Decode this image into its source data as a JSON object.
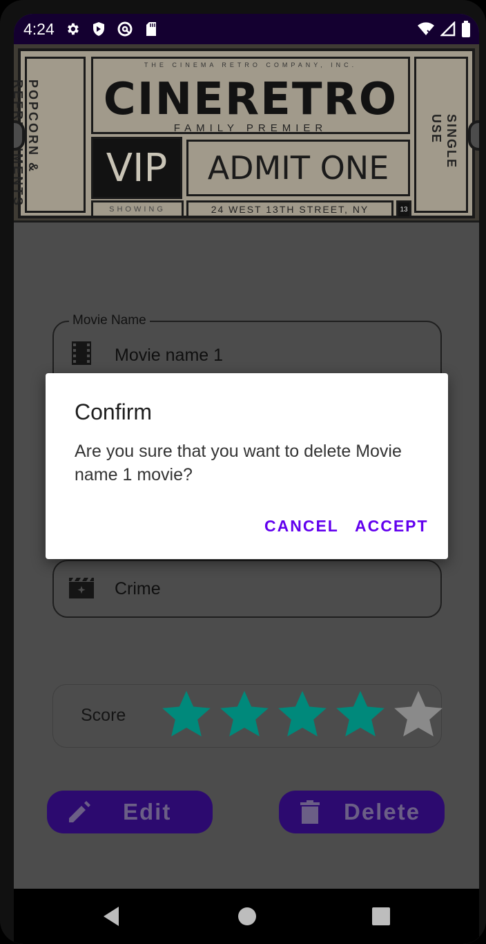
{
  "status_bar": {
    "time": "4:24",
    "icons": [
      "gear-icon",
      "shield-icon",
      "at-sign-icon",
      "sd-card-icon"
    ],
    "right_icons": [
      "wifi-off-icon",
      "signal-icon",
      "battery-icon"
    ]
  },
  "banner": {
    "small_top": "THE CINEMA RETRO COMPANY, INC.",
    "brand": "CINERETRO",
    "subtitle": "FAMILY PREMIER",
    "vip": "VIP",
    "admit": "ADMIT ONE",
    "left_text": "POPCORN & REFRESHMENTS",
    "right_text": "SINGLE USE",
    "showing": "SHOWING",
    "address": "24 WEST 13TH STREET, NY",
    "number": "13"
  },
  "form": {
    "movie_name_label": "Movie Name",
    "movie_name_value": "Movie name 1",
    "genre_value": "Crime",
    "score_label": "Score",
    "score_value": 4,
    "score_max": 5
  },
  "actions": {
    "edit_label": "Edit",
    "delete_label": "Delete"
  },
  "dialog": {
    "title": "Confirm",
    "message": "Are you sure that you want to delete Movie name 1 movie?",
    "cancel_label": "CANCEL",
    "accept_label": "ACCEPT"
  },
  "colors": {
    "accent": "#6200ee",
    "star_on": "#00897b",
    "star_off": "#8a8a8a",
    "button_bg": "#2c0a6f"
  }
}
